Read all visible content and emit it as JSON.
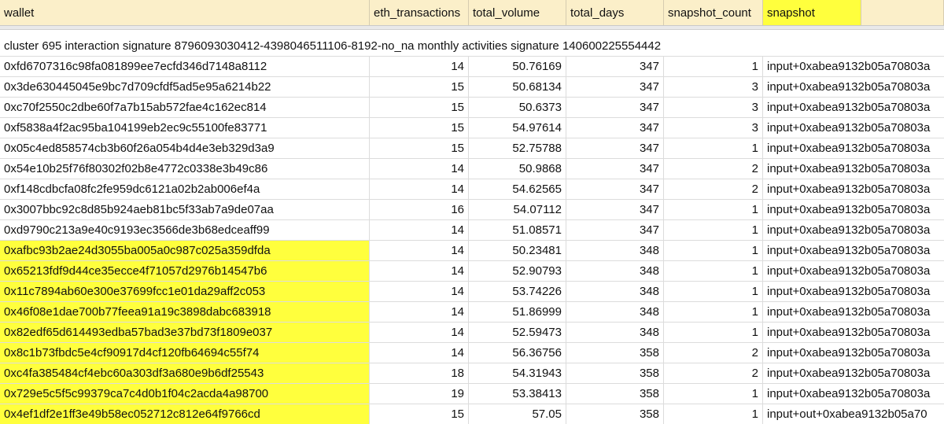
{
  "columns": {
    "wallet": "wallet",
    "eth_transactions": "eth_transactions",
    "total_volume": "total_volume",
    "total_days": "total_days",
    "snapshot_count": "snapshot_count",
    "snapshot": "snapshot"
  },
  "highlight_color": "#ffff3d",
  "header_color": "#fbefc9",
  "banner": "cluster 695 interaction signature 8796093030412-4398046511106-8192-no_na monthly activities signature 140600225554442",
  "rows": [
    {
      "wallet": "0xfd6707316c98fa081899ee7ecfd346d7148a8112",
      "eth": "14",
      "volume": "50.76169",
      "days": "347",
      "snap_count": "1",
      "snapshot": "input+0xabea9132b05a70803a",
      "highlight": false
    },
    {
      "wallet": "0x3de630445045e9bc7d709cfdf5ad5e95a6214b22",
      "eth": "15",
      "volume": "50.68134",
      "days": "347",
      "snap_count": "3",
      "snapshot": "input+0xabea9132b05a70803a",
      "highlight": false
    },
    {
      "wallet": "0xc70f2550c2dbe60f7a7b15ab572fae4c162ec814",
      "eth": "15",
      "volume": "50.6373",
      "days": "347",
      "snap_count": "3",
      "snapshot": "input+0xabea9132b05a70803a",
      "highlight": false
    },
    {
      "wallet": "0xf5838a4f2ac95ba104199eb2ec9c55100fe83771",
      "eth": "15",
      "volume": "54.97614",
      "days": "347",
      "snap_count": "3",
      "snapshot": "input+0xabea9132b05a70803a",
      "highlight": false
    },
    {
      "wallet": "0x05c4ed858574cb3b60f26a054b4d4e3eb329d3a9",
      "eth": "15",
      "volume": "52.75788",
      "days": "347",
      "snap_count": "1",
      "snapshot": "input+0xabea9132b05a70803a",
      "highlight": false
    },
    {
      "wallet": "0x54e10b25f76f80302f02b8e4772c0338e3b49c86",
      "eth": "14",
      "volume": "50.9868",
      "days": "347",
      "snap_count": "2",
      "snapshot": "input+0xabea9132b05a70803a",
      "highlight": false
    },
    {
      "wallet": "0xf148cdbcfa08fc2fe959dc6121a02b2ab006ef4a",
      "eth": "14",
      "volume": "54.62565",
      "days": "347",
      "snap_count": "2",
      "snapshot": "input+0xabea9132b05a70803a",
      "highlight": false
    },
    {
      "wallet": "0x3007bbc92c8d85b924aeb81bc5f33ab7a9de07aa",
      "eth": "16",
      "volume": "54.07112",
      "days": "347",
      "snap_count": "1",
      "snapshot": "input+0xabea9132b05a70803a",
      "highlight": false
    },
    {
      "wallet": "0xd9790c213a9e40c9193ec3566de3b68edceaff99",
      "eth": "14",
      "volume": "51.08571",
      "days": "347",
      "snap_count": "1",
      "snapshot": "input+0xabea9132b05a70803a",
      "highlight": false
    },
    {
      "wallet": "0xafbc93b2ae24d3055ba005a0c987c025a359dfda",
      "eth": "14",
      "volume": "50.23481",
      "days": "348",
      "snap_count": "1",
      "snapshot": "input+0xabea9132b05a70803a",
      "highlight": true
    },
    {
      "wallet": "0x65213fdf9d44ce35ecce4f71057d2976b14547b6",
      "eth": "14",
      "volume": "52.90793",
      "days": "348",
      "snap_count": "1",
      "snapshot": "input+0xabea9132b05a70803a",
      "highlight": true
    },
    {
      "wallet": "0x11c7894ab60e300e37699fcc1e01da29aff2c053",
      "eth": "14",
      "volume": "53.74226",
      "days": "348",
      "snap_count": "1",
      "snapshot": "input+0xabea9132b05a70803a",
      "highlight": true
    },
    {
      "wallet": "0x46f08e1dae700b77feea91a19c3898dabc683918",
      "eth": "14",
      "volume": "51.86999",
      "days": "348",
      "snap_count": "1",
      "snapshot": "input+0xabea9132b05a70803a",
      "highlight": true
    },
    {
      "wallet": "0x82edf65d614493edba57bad3e37bd73f1809e037",
      "eth": "14",
      "volume": "52.59473",
      "days": "348",
      "snap_count": "1",
      "snapshot": "input+0xabea9132b05a70803a",
      "highlight": true
    },
    {
      "wallet": "0x8c1b73fbdc5e4cf90917d4cf120fb64694c55f74",
      "eth": "14",
      "volume": "56.36756",
      "days": "358",
      "snap_count": "2",
      "snapshot": "input+0xabea9132b05a70803a",
      "highlight": true
    },
    {
      "wallet": "0xc4fa385484cf4ebc60a303df3a680e9b6df25543",
      "eth": "18",
      "volume": "54.31943",
      "days": "358",
      "snap_count": "2",
      "snapshot": "input+0xabea9132b05a70803a",
      "highlight": true
    },
    {
      "wallet": "0x729e5c5f5c99379ca7c4d0b1f04c2acda4a98700",
      "eth": "19",
      "volume": "53.38413",
      "days": "358",
      "snap_count": "1",
      "snapshot": "input+0xabea9132b05a70803a",
      "highlight": true
    },
    {
      "wallet": "0x4ef1df2e1ff3e49b58ec052712c812e64f9766cd",
      "eth": "15",
      "volume": "57.05",
      "days": "358",
      "snap_count": "1",
      "snapshot": "input+out+0xabea9132b05a70",
      "highlight": true
    }
  ]
}
